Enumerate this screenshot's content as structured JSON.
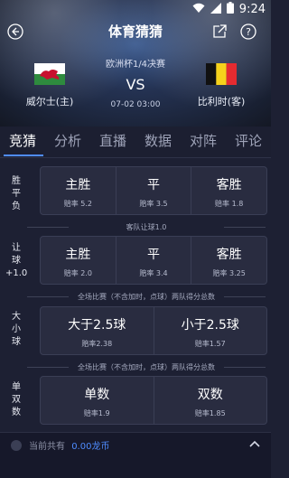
{
  "status": {
    "time": "9:24"
  },
  "header": {
    "title": "体育猜猜"
  },
  "match": {
    "stage": "欧洲杯1/4决赛",
    "home": "威尔士(主)",
    "away": "比利时(客)",
    "vs": "VS",
    "time": "07-02 03:00"
  },
  "tabs": [
    {
      "label": "竞猜"
    },
    {
      "label": "分析"
    },
    {
      "label": "直播"
    },
    {
      "label": "数据"
    },
    {
      "label": "对阵"
    },
    {
      "label": "评论"
    }
  ],
  "bets": {
    "win_draw_lose": {
      "label": "胜平负",
      "options": [
        {
          "label": "主胜",
          "odds": "赔率 5.2"
        },
        {
          "label": "平",
          "odds": "赔率 3.5"
        },
        {
          "label": "客胜",
          "odds": "赔率 1.8"
        }
      ]
    },
    "handicap": {
      "note": "客队让球1.0",
      "label": "让球",
      "value": "+1.0",
      "options": [
        {
          "label": "主胜",
          "odds": "赔率 2.0"
        },
        {
          "label": "平",
          "odds": "赔率 3.4"
        },
        {
          "label": "客胜",
          "odds": "赔率 3.25"
        }
      ]
    },
    "over_under": {
      "note": "全场比赛（不含加时，点球）两队得分总数",
      "label": "大小球",
      "options": [
        {
          "label": "大于2.5球",
          "odds": "赔率2.38"
        },
        {
          "label": "小于2.5球",
          "odds": "赔率1.57"
        }
      ]
    },
    "odd_even": {
      "note": "全场比赛（不含加时，点球）两队得分总数",
      "label": "单双数",
      "options": [
        {
          "label": "单数",
          "odds": "赔率1.9"
        },
        {
          "label": "双数",
          "odds": "赔率1.85"
        }
      ]
    }
  },
  "footer": {
    "balance_label": "当前共有",
    "balance_value": "0.00龙币"
  },
  "colors": {
    "accent": "#4f8cff",
    "background": "#1d2033",
    "card": "#292c40"
  }
}
